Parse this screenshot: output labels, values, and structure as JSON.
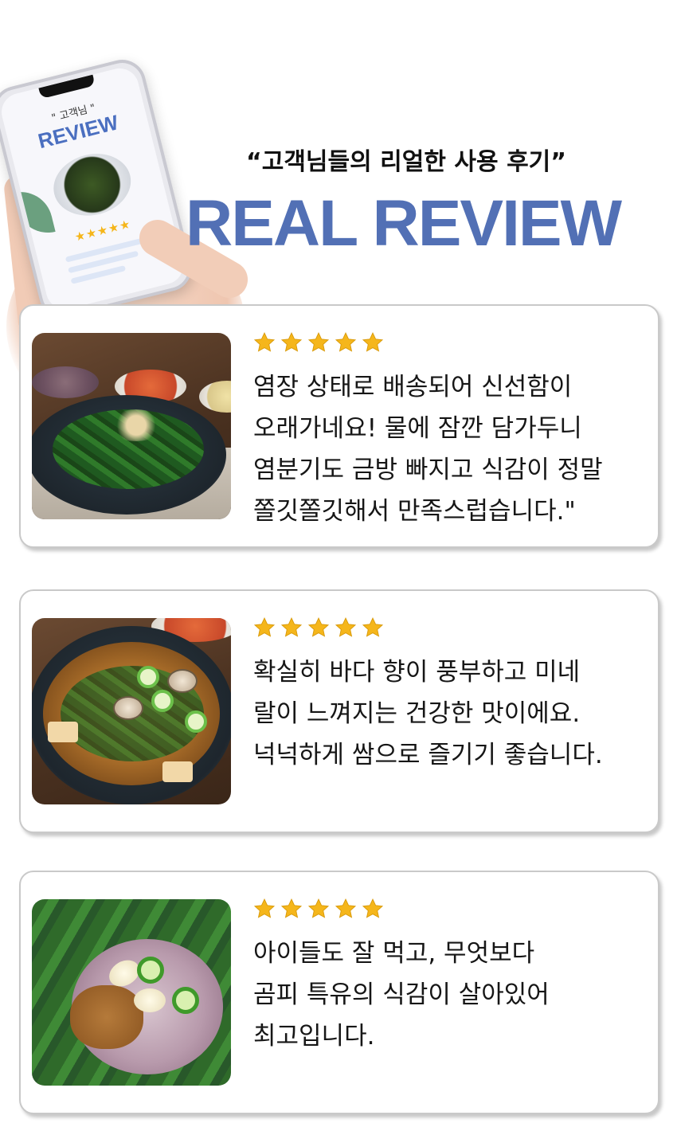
{
  "header": {
    "phone_badge": "\" 고객님 \"",
    "phone_title": "REVIEW",
    "phone_stars": "★★★★★",
    "headline": "“고객님들의 리얼한 사용 후기”",
    "title": "REAL REVIEW"
  },
  "colors": {
    "accent": "#5270b5",
    "star": "#f5b61b"
  },
  "reviews": [
    {
      "rating": 5,
      "text": "염장 상태로 배송되어 신선함이\n오래가네요! 물에 잠깐 담가두니\n염분기도 금방 빠지고 식감이 정말\n쫄깃쫄깃해서 만족스럽습니다.\""
    },
    {
      "rating": 5,
      "text": "확실히 바다 향이 풍부하고 미네\n랄이 느껴지는 건강한 맛이에요.\n넉넉하게 쌈으로 즐기기 좋습니다."
    },
    {
      "rating": 5,
      "text": "아이들도 잘 먹고, 무엇보다\n곰피 특유의 식감이 살아있어\n최고입니다."
    }
  ]
}
